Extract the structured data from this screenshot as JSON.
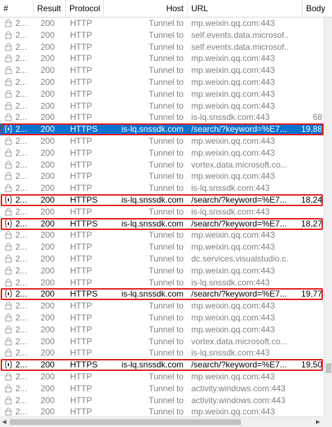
{
  "columns": {
    "num": "#",
    "result": "Result",
    "protocol": "Protocol",
    "host": "Host",
    "url": "URL",
    "body": "Body"
  },
  "rows": [
    {
      "num": "2...",
      "result": "200",
      "protocol": "HTTP",
      "host": "Tunnel to",
      "url": "mp.weixin.qq.com:443",
      "body": "",
      "type": "tunnel"
    },
    {
      "num": "2...",
      "result": "200",
      "protocol": "HTTP",
      "host": "Tunnel to",
      "url": "self.events.data.microsof...",
      "body": "",
      "type": "tunnel"
    },
    {
      "num": "2...",
      "result": "200",
      "protocol": "HTTP",
      "host": "Tunnel to",
      "url": "self.events.data.microsof...",
      "body": "",
      "type": "tunnel"
    },
    {
      "num": "2...",
      "result": "200",
      "protocol": "HTTP",
      "host": "Tunnel to",
      "url": "mp.weixin.qq.com:443",
      "body": "",
      "type": "tunnel"
    },
    {
      "num": "2...",
      "result": "200",
      "protocol": "HTTP",
      "host": "Tunnel to",
      "url": "mp.weixin.qq.com:443",
      "body": "",
      "type": "tunnel"
    },
    {
      "num": "2...",
      "result": "200",
      "protocol": "HTTP",
      "host": "Tunnel to",
      "url": "mp.weixin.qq.com:443",
      "body": "",
      "type": "tunnel"
    },
    {
      "num": "2...",
      "result": "200",
      "protocol": "HTTP",
      "host": "Tunnel to",
      "url": "mp.weixin.qq.com:443",
      "body": "",
      "type": "tunnel"
    },
    {
      "num": "2...",
      "result": "200",
      "protocol": "HTTP",
      "host": "Tunnel to",
      "url": "mp.weixin.qq.com:443",
      "body": "",
      "type": "tunnel"
    },
    {
      "num": "2...",
      "result": "200",
      "protocol": "HTTP",
      "host": "Tunnel to",
      "url": "is-lq.snssdk.com:443",
      "body": "68",
      "type": "tunnel"
    },
    {
      "num": "2...",
      "result": "200",
      "protocol": "HTTPS",
      "host": "is-lq.snssdk.com",
      "url": "/search/?keyword=%E7...",
      "body": "19,88",
      "type": "https",
      "selected": true,
      "highlight": true
    },
    {
      "num": "2...",
      "result": "200",
      "protocol": "HTTP",
      "host": "Tunnel to",
      "url": "mp.weixin.qq.com:443",
      "body": "",
      "type": "tunnel"
    },
    {
      "num": "2...",
      "result": "200",
      "protocol": "HTTP",
      "host": "Tunnel to",
      "url": "mp.weixin.qq.com:443",
      "body": "",
      "type": "tunnel"
    },
    {
      "num": "2...",
      "result": "200",
      "protocol": "HTTP",
      "host": "Tunnel to",
      "url": "vortex.data.microsoft.co...",
      "body": "",
      "type": "tunnel"
    },
    {
      "num": "2...",
      "result": "200",
      "protocol": "HTTP",
      "host": "Tunnel to",
      "url": "mp.weixin.qq.com:443",
      "body": "",
      "type": "tunnel"
    },
    {
      "num": "2...",
      "result": "200",
      "protocol": "HTTP",
      "host": "Tunnel to",
      "url": "is-lq.snssdk.com:443",
      "body": "",
      "type": "tunnel"
    },
    {
      "num": "2...",
      "result": "200",
      "protocol": "HTTPS",
      "host": "is-lq.snssdk.com",
      "url": "/search/?keyword=%E7...",
      "body": "18,24",
      "type": "https",
      "highlight": true
    },
    {
      "num": "2...",
      "result": "200",
      "protocol": "HTTP",
      "host": "Tunnel to",
      "url": "is-lq.snssdk.com:443",
      "body": "",
      "type": "tunnel"
    },
    {
      "num": "2...",
      "result": "200",
      "protocol": "HTTPS",
      "host": "is-lq.snssdk.com",
      "url": "/search/?keyword=%E7...",
      "body": "18,27",
      "type": "https",
      "highlight": true
    },
    {
      "num": "2...",
      "result": "200",
      "protocol": "HTTP",
      "host": "Tunnel to",
      "url": "mp.weixin.qq.com:443",
      "body": "",
      "type": "tunnel"
    },
    {
      "num": "2...",
      "result": "200",
      "protocol": "HTTP",
      "host": "Tunnel to",
      "url": "mp.weixin.qq.com:443",
      "body": "",
      "type": "tunnel"
    },
    {
      "num": "2...",
      "result": "200",
      "protocol": "HTTP",
      "host": "Tunnel to",
      "url": "dc.services.visualstudio.c...",
      "body": "",
      "type": "tunnel"
    },
    {
      "num": "2...",
      "result": "200",
      "protocol": "HTTP",
      "host": "Tunnel to",
      "url": "mp.weixin.qq.com:443",
      "body": "",
      "type": "tunnel"
    },
    {
      "num": "2...",
      "result": "200",
      "protocol": "HTTP",
      "host": "Tunnel to",
      "url": "is-lq.snssdk.com:443",
      "body": "",
      "type": "tunnel"
    },
    {
      "num": "2...",
      "result": "200",
      "protocol": "HTTPS",
      "host": "is-lq.snssdk.com",
      "url": "/search/?keyword=%E7...",
      "body": "19,77",
      "type": "https",
      "highlight": true
    },
    {
      "num": "2...",
      "result": "200",
      "protocol": "HTTP",
      "host": "Tunnel to",
      "url": "mp.weixin.qq.com:443",
      "body": "",
      "type": "tunnel"
    },
    {
      "num": "2...",
      "result": "200",
      "protocol": "HTTP",
      "host": "Tunnel to",
      "url": "mp.weixin.qq.com:443",
      "body": "",
      "type": "tunnel"
    },
    {
      "num": "2...",
      "result": "200",
      "protocol": "HTTP",
      "host": "Tunnel to",
      "url": "mp.weixin.qq.com:443",
      "body": "",
      "type": "tunnel"
    },
    {
      "num": "2...",
      "result": "200",
      "protocol": "HTTP",
      "host": "Tunnel to",
      "url": "vortex.data.microsoft.co...",
      "body": "",
      "type": "tunnel"
    },
    {
      "num": "2...",
      "result": "200",
      "protocol": "HTTP",
      "host": "Tunnel to",
      "url": "is-lq.snssdk.com:443",
      "body": "",
      "type": "tunnel"
    },
    {
      "num": "2...",
      "result": "200",
      "protocol": "HTTPS",
      "host": "is-lq.snssdk.com",
      "url": "/search/?keyword=%E7...",
      "body": "19,50",
      "type": "https",
      "highlight": true
    },
    {
      "num": "2...",
      "result": "200",
      "protocol": "HTTP",
      "host": "Tunnel to",
      "url": "mp.weixin.qq.com:443",
      "body": "",
      "type": "tunnel"
    },
    {
      "num": "2...",
      "result": "200",
      "protocol": "HTTP",
      "host": "Tunnel to",
      "url": "activity.windows.com:443",
      "body": "",
      "type": "tunnel"
    },
    {
      "num": "2...",
      "result": "200",
      "protocol": "HTTP",
      "host": "Tunnel to",
      "url": "activity.windows.com:443",
      "body": "",
      "type": "tunnel"
    },
    {
      "num": "2...",
      "result": "200",
      "protocol": "HTTP",
      "host": "Tunnel to",
      "url": "mp.weixin.qq.com:443",
      "body": "",
      "type": "tunnel"
    },
    {
      "num": "2...",
      "result": "200",
      "protocol": "HTTP",
      "host": "Tunnel to",
      "url": "mp.weixin.qq.com:443",
      "body": "",
      "type": "tunnel"
    }
  ],
  "icons": {
    "tunnel": "lock-icon",
    "https": "json-icon"
  },
  "colors": {
    "selection": "#0a72d1",
    "highlight_border": "#e21818",
    "tunnel_text": "#808080"
  }
}
